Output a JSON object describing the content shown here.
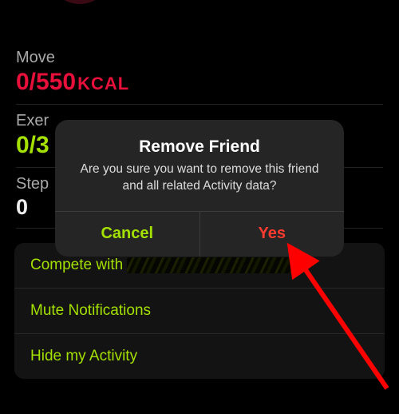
{
  "metrics": {
    "move": {
      "label": "Move",
      "value": "0/550",
      "unit": "KCAL"
    },
    "exercise": {
      "label": "Exer",
      "value": "0/3"
    },
    "steps": {
      "label": "Step",
      "value": "0"
    }
  },
  "options": {
    "compete_prefix": "Compete with ",
    "mute": "Mute Notifications",
    "hide": "Hide my Activity"
  },
  "modal": {
    "title": "Remove Friend",
    "message": "Are you sure you want to remove this friend and all related Activity data?",
    "cancel": "Cancel",
    "confirm": "Yes"
  }
}
